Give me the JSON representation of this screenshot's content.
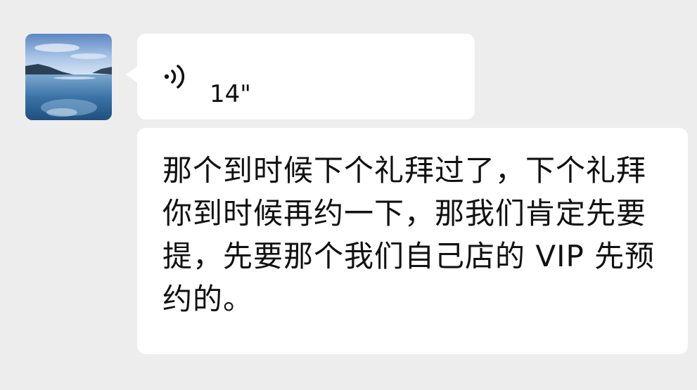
{
  "message": {
    "voice": {
      "duration": "14\"",
      "icon": "voice-wave-icon"
    },
    "transcription": "那个到时候下个礼拜过了，下个礼拜你到时候再约一下，那我们肯定先要提，先要那个我们自己店的 VIP 先预约的。"
  },
  "avatar": {
    "icon": "landscape-avatar"
  },
  "colors": {
    "background": "#ededed",
    "bubble": "#ffffff",
    "text": "#111111"
  }
}
